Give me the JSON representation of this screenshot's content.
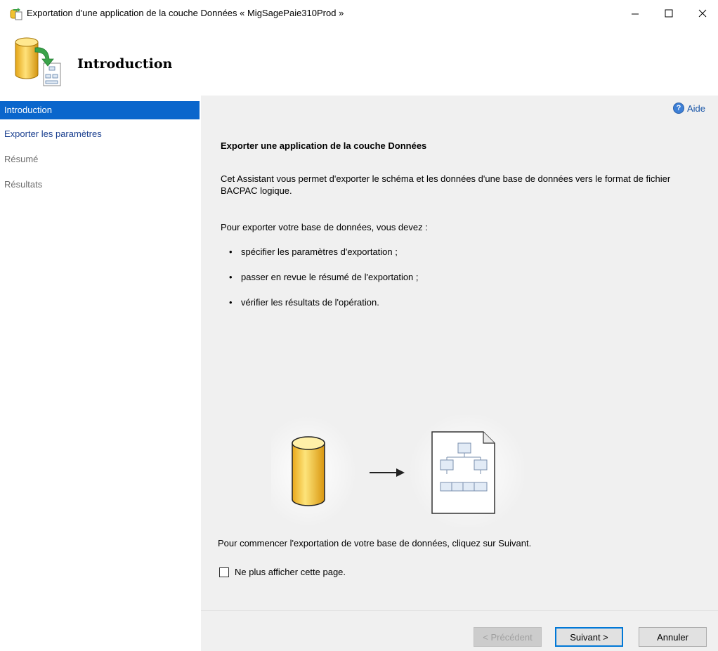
{
  "window": {
    "title": "Exportation d'une application de la couche Données « MigSagePaie310Prod »"
  },
  "banner": {
    "title": "Introduction"
  },
  "nav": {
    "items": [
      {
        "label": "Introduction",
        "state": "active"
      },
      {
        "label": "Exporter les paramètres",
        "state": "link"
      },
      {
        "label": "Résumé",
        "state": "disabled"
      },
      {
        "label": "Résultats",
        "state": "disabled"
      }
    ]
  },
  "content": {
    "help_label": "Aide",
    "heading": "Exporter une application de la couche Données",
    "para1": "Cet Assistant vous permet d'exporter le schéma et les données d'une base de données vers le format de fichier BACPAC logique.",
    "para2": "Pour exporter votre base de données, vous devez :",
    "bullets": [
      "spécifier les paramètres d'exportation ;",
      "passer en revue le résumé de l'exportation ;",
      "vérifier les résultats de l'opération."
    ],
    "start_text": "Pour commencer l'exportation de votre base de données, cliquez sur Suivant.",
    "checkbox_label": "Ne plus afficher cette page.",
    "checkbox_checked": false
  },
  "footer": {
    "prev_label": "< Précédent",
    "next_label": "Suivant >",
    "cancel_label": "Annuler"
  },
  "colors": {
    "accent": "#0a66cc",
    "content_bg": "#f0f0f0",
    "link": "#1a3f8f",
    "db_yellow": "#f2c230",
    "arrow_green": "#3aa34a"
  }
}
